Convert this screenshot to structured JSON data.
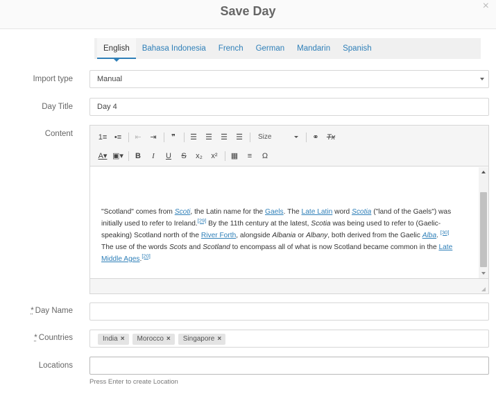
{
  "dialog": {
    "title": "Save Day",
    "close_glyph": "×"
  },
  "language_tabs": [
    "English",
    "Bahasa Indonesia",
    "French",
    "German",
    "Mandarin",
    "Spanish"
  ],
  "active_language": "English",
  "form": {
    "import_type": {
      "label": "Import type",
      "value": "Manual"
    },
    "day_title": {
      "label": "Day Title",
      "value": "Day 4"
    },
    "content": {
      "label": "Content"
    },
    "day_name": {
      "label": "Day Name",
      "required_mark": "*",
      "value": ""
    },
    "countries": {
      "label": "Countries",
      "required_mark": "*",
      "tags": [
        "India",
        "Morocco",
        "Singapore"
      ],
      "remove_glyph": "×"
    },
    "locations": {
      "label": "Locations",
      "value": "",
      "hint": "Press Enter to create Location"
    }
  },
  "toolbar": {
    "row1": [
      {
        "name": "numbered-list-icon",
        "glyph": "1≡"
      },
      {
        "name": "bulleted-list-icon",
        "glyph": "•≡"
      },
      {
        "name": "decrease-indent-icon",
        "glyph": "⇤",
        "disabled": true
      },
      {
        "name": "increase-indent-icon",
        "glyph": "⇥"
      },
      {
        "name": "blockquote-icon",
        "glyph": "❞"
      },
      {
        "name": "align-left-icon",
        "glyph": "☰"
      },
      {
        "name": "align-center-icon",
        "glyph": "☰"
      },
      {
        "name": "align-right-icon",
        "glyph": "☰"
      },
      {
        "name": "align-justify-icon",
        "glyph": "☰"
      }
    ],
    "size_label": "Size",
    "link_glyph": "⚭",
    "clear_format_glyph": "Tx",
    "row2": [
      {
        "name": "text-color-icon",
        "glyph": "A▾"
      },
      {
        "name": "background-color-icon",
        "glyph": "▣▾"
      },
      {
        "name": "bold-icon",
        "glyph": "B"
      },
      {
        "name": "italic-icon",
        "glyph": "I"
      },
      {
        "name": "underline-icon",
        "glyph": "U"
      },
      {
        "name": "strikethrough-icon",
        "glyph": "S"
      },
      {
        "name": "subscript-icon",
        "glyph": "x₂"
      },
      {
        "name": "superscript-icon",
        "glyph": "x²"
      },
      {
        "name": "table-icon",
        "glyph": "▦"
      },
      {
        "name": "horizontal-line-icon",
        "glyph": "≡"
      },
      {
        "name": "special-char-icon",
        "glyph": "Ω"
      }
    ]
  },
  "content_body": {
    "segments": [
      {
        "t": "\"Scotland\" comes from "
      },
      {
        "t": "Scoti",
        "link": true,
        "italic": true
      },
      {
        "t": ", the Latin name for the "
      },
      {
        "t": "Gaels",
        "link": true
      },
      {
        "t": ". The "
      },
      {
        "t": "Late Latin",
        "link": true
      },
      {
        "t": " word "
      },
      {
        "t": "Scotia",
        "link": true,
        "italic": true
      },
      {
        "t": " (\"land of the Gaels\") was initially used to refer to Ireland."
      },
      {
        "t": "[29]",
        "link": true,
        "sup": true
      },
      {
        "t": " By the 11th century at the latest, "
      },
      {
        "t": "Scotia",
        "italic": true
      },
      {
        "t": " was being used to refer to (Gaelic-speaking) Scotland north of the "
      },
      {
        "t": "River Forth",
        "link": true
      },
      {
        "t": ", alongside "
      },
      {
        "t": "Albania",
        "italic": true
      },
      {
        "t": " or "
      },
      {
        "t": "Albany",
        "italic": true
      },
      {
        "t": ", both derived from the Gaelic "
      },
      {
        "t": "Alba",
        "link": true,
        "italic": true
      },
      {
        "t": ". "
      },
      {
        "t": "[30]",
        "link": true,
        "sup": true
      },
      {
        "t": " The use of the words "
      },
      {
        "t": "Scots",
        "italic": true
      },
      {
        "t": " and "
      },
      {
        "t": "Scotland",
        "italic": true
      },
      {
        "t": " to encompass all of what is now Scotland became common in the "
      },
      {
        "t": "Late Middle Ages",
        "link": true
      },
      {
        "t": "."
      },
      {
        "t": "[20]",
        "link": true,
        "sup": true
      }
    ]
  }
}
